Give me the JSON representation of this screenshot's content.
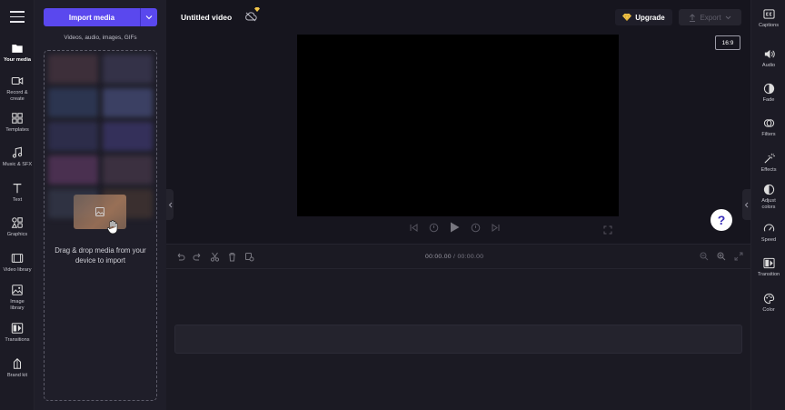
{
  "rail": {
    "items": [
      {
        "label": "Your media"
      },
      {
        "label": "Record & create"
      },
      {
        "label": "Templates"
      },
      {
        "label": "Music & SFX"
      },
      {
        "label": "Text"
      },
      {
        "label": "Graphics"
      },
      {
        "label": "Video library"
      },
      {
        "label": "Image library"
      },
      {
        "label": "Transitions"
      },
      {
        "label": "Brand kit"
      }
    ]
  },
  "media": {
    "import_label": "Import media",
    "subtitle": "Videos, audio, images, GIFs",
    "drop_text": "Drag & drop media from your device to import"
  },
  "header": {
    "title": "Untitled video",
    "upgrade_label": "Upgrade",
    "export_label": "Export",
    "aspect_ratio": "16:9"
  },
  "timeline": {
    "current_time": "00:00.00",
    "separator": " / ",
    "total_time": "00:00.00"
  },
  "right_panel": {
    "items": [
      {
        "label": "Captions"
      },
      {
        "label": "Audio"
      },
      {
        "label": "Fade"
      },
      {
        "label": "Filters"
      },
      {
        "label": "Effects"
      },
      {
        "label": "Adjust colors"
      },
      {
        "label": "Speed"
      },
      {
        "label": "Transition"
      },
      {
        "label": "Color"
      }
    ]
  },
  "help": {
    "label": "?"
  },
  "colors": {
    "accent": "#5a48ee",
    "background": "#16151e",
    "panel": "#1f1e29",
    "upgrade_gem": "#f3c64a"
  }
}
